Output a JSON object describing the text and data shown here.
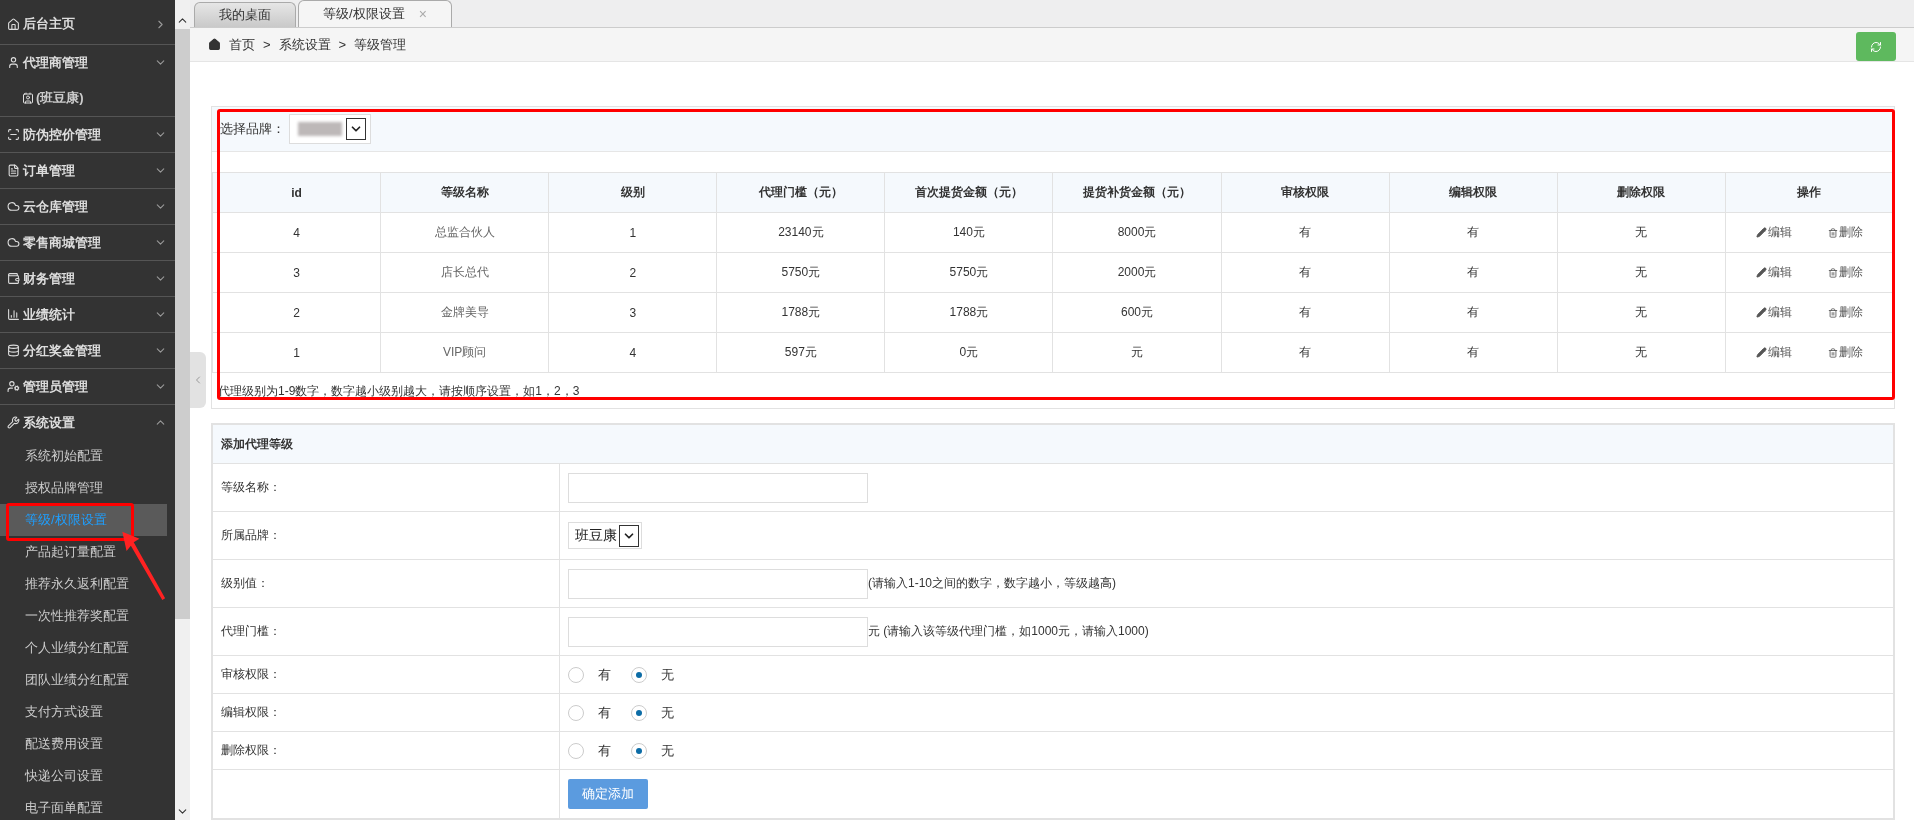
{
  "sidebar": {
    "items": [
      {
        "label": "后台主页"
      },
      {
        "label": "代理商管理",
        "expanded": false,
        "children": [
          {
            "label": "(班豆康)",
            "selected": false
          }
        ]
      },
      {
        "label": "防伪控价管理",
        "expanded": false
      },
      {
        "label": "订单管理",
        "expanded": false
      },
      {
        "label": "云仓库管理",
        "expanded": false
      },
      {
        "label": "零售商城管理",
        "expanded": false
      },
      {
        "label": "财务管理",
        "expanded": false
      },
      {
        "label": "业绩统计",
        "expanded": false
      },
      {
        "label": "分红奖金管理",
        "expanded": false
      },
      {
        "label": "管理员管理",
        "expanded": false
      },
      {
        "label": "系统设置",
        "expanded": true,
        "children": [
          {
            "label": "系统初始配置",
            "selected": false
          },
          {
            "label": "授权品牌管理",
            "selected": false
          },
          {
            "label": "等级/权限设置",
            "selected": true
          },
          {
            "label": "产品起订量配置",
            "selected": false
          },
          {
            "label": "推荐永久返利配置",
            "selected": false
          },
          {
            "label": "一次性推荐奖配置",
            "selected": false
          },
          {
            "label": "个人业绩分红配置",
            "selected": false
          },
          {
            "label": "团队业绩分红配置",
            "selected": false
          },
          {
            "label": "支付方式设置",
            "selected": false
          },
          {
            "label": "配送费用设置",
            "selected": false
          },
          {
            "label": "快递公司设置",
            "selected": false
          },
          {
            "label": "电子面单配置",
            "selected": false
          }
        ]
      }
    ]
  },
  "tabs": [
    {
      "label": "我的桌面",
      "selected": false
    },
    {
      "label": "等级/权限设置",
      "selected": true,
      "close": "×"
    }
  ],
  "breadcrumb": {
    "separator": ">",
    "items": [
      "首页",
      "系统设置",
      "等级管理"
    ]
  },
  "brand_filter": {
    "label": "选择品牌："
  },
  "table": {
    "columns": [
      "id",
      "等级名称",
      "级别",
      "代理门槛（元）",
      "首次提货金额（元）",
      "提货补货金额（元）",
      "审核权限",
      "编辑权限",
      "删除权限",
      "操作"
    ],
    "rows": [
      {
        "cells": [
          "4",
          "总监合伙人",
          "1",
          "23140元",
          "140元",
          "8000元",
          "有",
          "有",
          "无"
        ],
        "actions": [
          "编辑",
          "删除"
        ]
      },
      {
        "cells": [
          "3",
          "店长总代",
          "2",
          "5750元",
          "5750元",
          "2000元",
          "有",
          "有",
          "无"
        ],
        "actions": [
          "编辑",
          "删除"
        ]
      },
      {
        "cells": [
          "2",
          "金牌美导",
          "3",
          "1788元",
          "1788元",
          "600元",
          "有",
          "有",
          "无"
        ],
        "actions": [
          "编辑",
          "删除"
        ]
      },
      {
        "cells": [
          "1",
          "VIP顾问",
          "4",
          "597元",
          "0元",
          "元",
          "有",
          "有",
          "无"
        ],
        "actions": [
          "编辑",
          "删除"
        ]
      }
    ],
    "note": "代理级别为1-9数字，数字越小级别越大，请按顺序设置，如1，2，3"
  },
  "form": {
    "title": "添加代理等级",
    "fields": [
      {
        "kind": "text",
        "label": "等级名称："
      },
      {
        "kind": "select",
        "label": "所属品牌：",
        "value": "班豆康"
      },
      {
        "kind": "text",
        "label": "级别值：",
        "hint": "(请输入1-10之间的数字，数字越小，等级越高)"
      },
      {
        "kind": "text",
        "label": "代理门槛：",
        "hint": "元 (请输入该等级代理门槛，如1000元，请输入1000)"
      },
      {
        "kind": "radio",
        "label": "审核权限：",
        "options": [
          {
            "label": "有",
            "selected": false
          },
          {
            "label": "无",
            "selected": true
          }
        ]
      },
      {
        "kind": "radio",
        "label": "编辑权限：",
        "options": [
          {
            "label": "有",
            "selected": false
          },
          {
            "label": "无",
            "selected": true
          }
        ]
      },
      {
        "kind": "radio",
        "label": "删除权限：",
        "options": [
          {
            "label": "有",
            "selected": false
          },
          {
            "label": "无",
            "selected": true
          }
        ]
      },
      {
        "kind": "button",
        "label": "确定添加"
      }
    ]
  }
}
